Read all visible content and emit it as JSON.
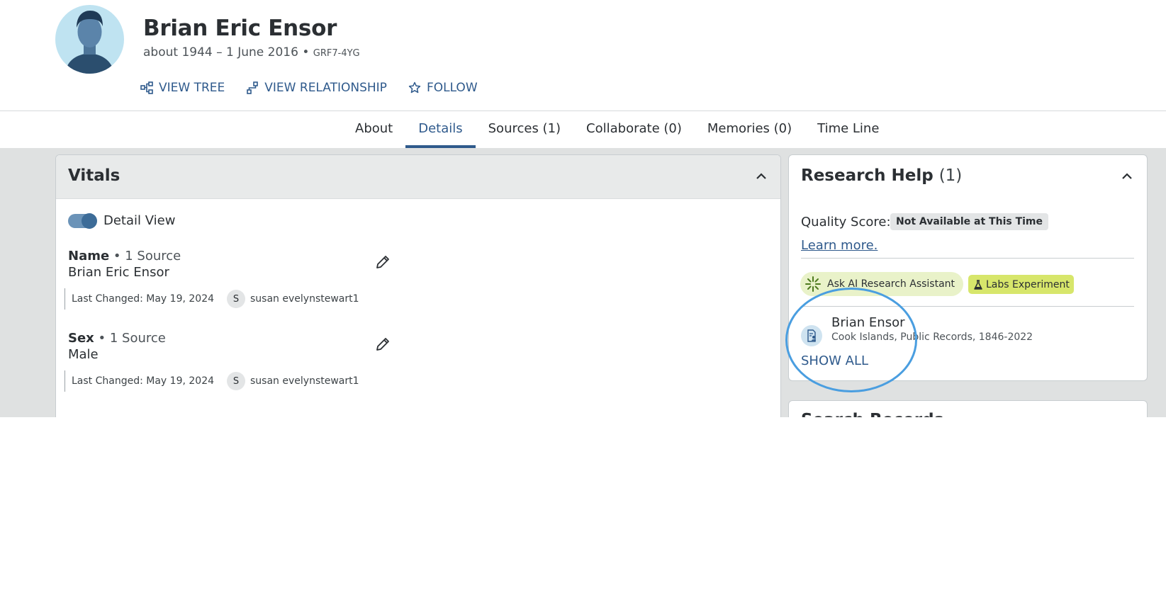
{
  "person": {
    "name": "Brian Eric Ensor",
    "lifespan": "about 1944 – 1 June 2016",
    "separator": " • ",
    "pid": "GRF7-4YG"
  },
  "actions": {
    "view_tree": "VIEW TREE",
    "view_relationship": "VIEW RELATIONSHIP",
    "follow": "FOLLOW"
  },
  "tabs": [
    {
      "label": "About"
    },
    {
      "label": "Details"
    },
    {
      "label": "Sources (1)"
    },
    {
      "label": "Collaborate (0)"
    },
    {
      "label": "Memories (0)"
    },
    {
      "label": "Time Line"
    }
  ],
  "active_tab": "Details",
  "vitals": {
    "title": "Vitals",
    "toggle_label": "Detail View",
    "toggle_on": true,
    "fields": [
      {
        "label": "Name",
        "sources": "• 1 Source",
        "value": "Brian Eric Ensor",
        "last_changed": "Last Changed: May 19, 2024",
        "user_initial": "S",
        "user": "susan evelynstewart1"
      },
      {
        "label": "Sex",
        "sources": "• 1 Source",
        "value": "Male",
        "last_changed": "Last Changed: May 19, 2024",
        "user_initial": "S",
        "user": "susan evelynstewart1"
      }
    ]
  },
  "research": {
    "title": "Research Help",
    "count": "(1)",
    "quality_label": "Quality Score:",
    "quality_value": "Not Available at This Time",
    "learn_more": "Learn more.",
    "ai_button": "Ask AI Research Assistant",
    "labs_badge": "Labs Experiment",
    "record_name": "Brian Ensor",
    "record_sub": "Cook Islands, Public Records, 1846-2022",
    "show_all": "SHOW ALL"
  },
  "search_records": {
    "title": "Search Records"
  },
  "colors": {
    "link": "#2f5a8c",
    "annotation": "#4a9ee0",
    "labs": "#d7e66b",
    "ai": "#e9f2c9"
  }
}
